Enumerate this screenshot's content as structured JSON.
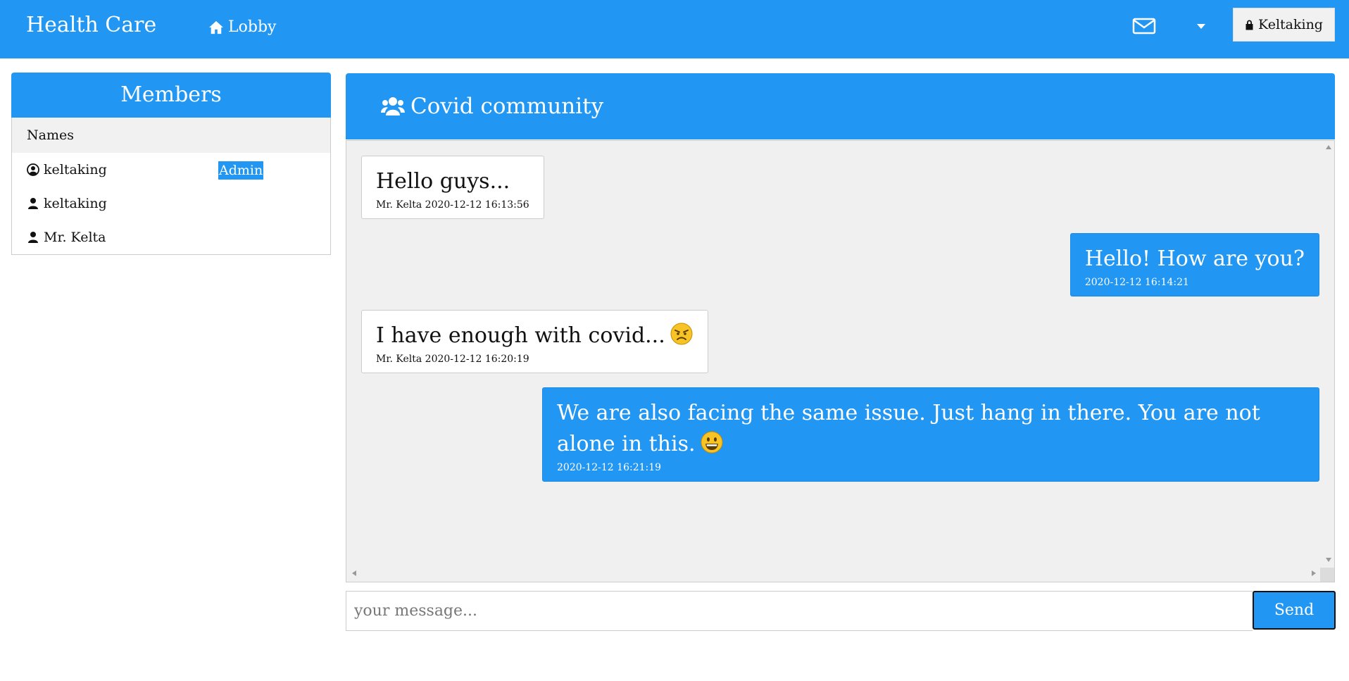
{
  "navbar": {
    "brand": "Health Care",
    "lobby_label": "Lobby",
    "user_label": "Keltaking",
    "color": "#2196f3"
  },
  "members": {
    "title": "Members",
    "column_header": "Names",
    "rows": [
      {
        "name": "keltaking",
        "icon": "user-circle-icon",
        "badge": "Admin"
      },
      {
        "name": "keltaking",
        "icon": "user-icon",
        "badge": ""
      },
      {
        "name": "Mr. Kelta",
        "icon": "user-icon",
        "badge": ""
      }
    ]
  },
  "chat": {
    "title": "Covid community",
    "icon": "users-icon",
    "messages": [
      {
        "direction": "incoming",
        "text": "Hello guys...",
        "meta": "Mr. Kelta 2020-12-12 16:13:56",
        "emoji": ""
      },
      {
        "direction": "outgoing",
        "text": "Hello! How are you?",
        "meta": "2020-12-12 16:14:21",
        "emoji": ""
      },
      {
        "direction": "incoming",
        "text": "I have enough with covid...",
        "meta": "Mr. Kelta 2020-12-12 16:20:19",
        "emoji": "angry-face"
      },
      {
        "direction": "outgoing",
        "text": "We are also facing the same issue. Just hang in there. You are not alone in this.",
        "meta": "2020-12-12 16:21:19",
        "emoji": "grinning-face"
      }
    ]
  },
  "composer": {
    "placeholder": "your message...",
    "value": "",
    "send_label": "Send"
  }
}
